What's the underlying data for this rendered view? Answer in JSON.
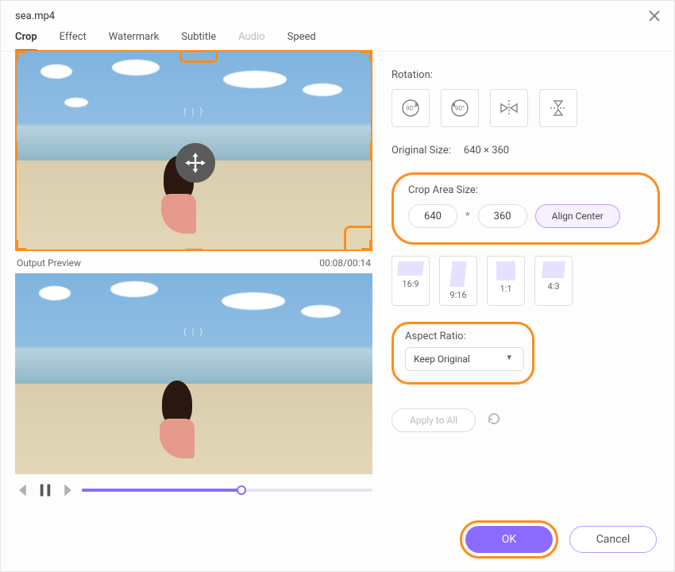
{
  "window": {
    "title": "sea.mp4"
  },
  "tabs": {
    "crop": "Crop",
    "effect": "Effect",
    "watermark": "Watermark",
    "subtitle": "Subtitle",
    "audio": "Audio",
    "speed": "Speed"
  },
  "preview": {
    "label": "Output Preview",
    "time": "00:08/00:14"
  },
  "rotation": {
    "label": "Rotation:"
  },
  "original_size": {
    "label": "Original Size:",
    "value": "640 × 360"
  },
  "crop_area": {
    "label": "Crop Area Size:",
    "w": "640",
    "h": "360",
    "sep": "*",
    "align": "Align Center"
  },
  "ratios": {
    "r169": "16:9",
    "r916": "9:16",
    "r11": "1:1",
    "r43": "4:3"
  },
  "aspect": {
    "label": "Aspect Ratio:",
    "value": "Keep Original"
  },
  "apply_all": "Apply to All",
  "footer": {
    "ok": "OK",
    "cancel": "Cancel"
  }
}
